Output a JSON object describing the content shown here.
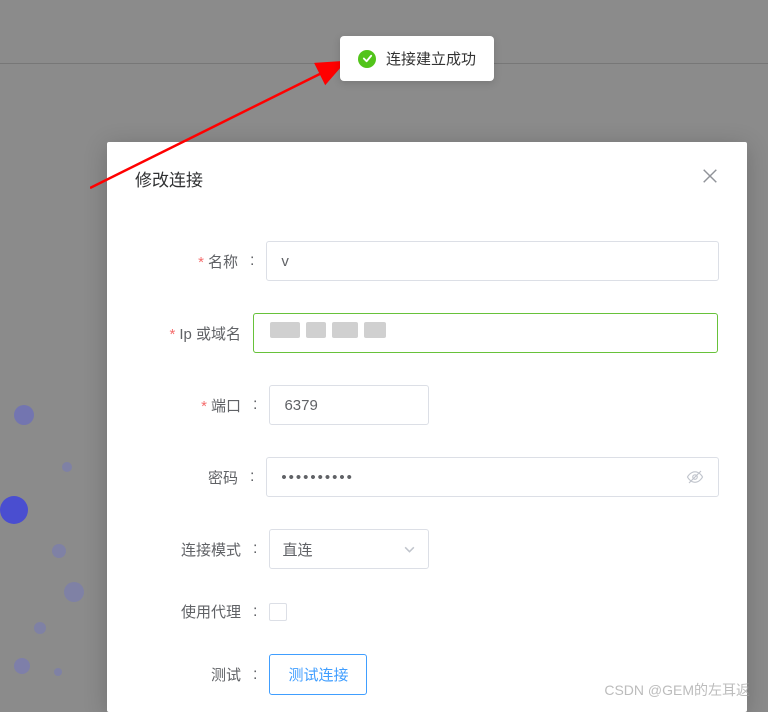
{
  "toast": {
    "message": "连接建立成功"
  },
  "dialog": {
    "title": "修改连接",
    "fields": {
      "name": {
        "label": "名称",
        "value": "v"
      },
      "ip": {
        "label": "Ip 或域名",
        "value": ""
      },
      "port": {
        "label": "端口",
        "value": "6379"
      },
      "password": {
        "label": "密码",
        "value": "••••••••••"
      },
      "mode": {
        "label": "连接模式",
        "value": "直连"
      },
      "proxy": {
        "label": "使用代理"
      },
      "test": {
        "label": "测试",
        "button": "测试连接"
      }
    }
  },
  "watermark": "CSDN @GEM的左耳返"
}
